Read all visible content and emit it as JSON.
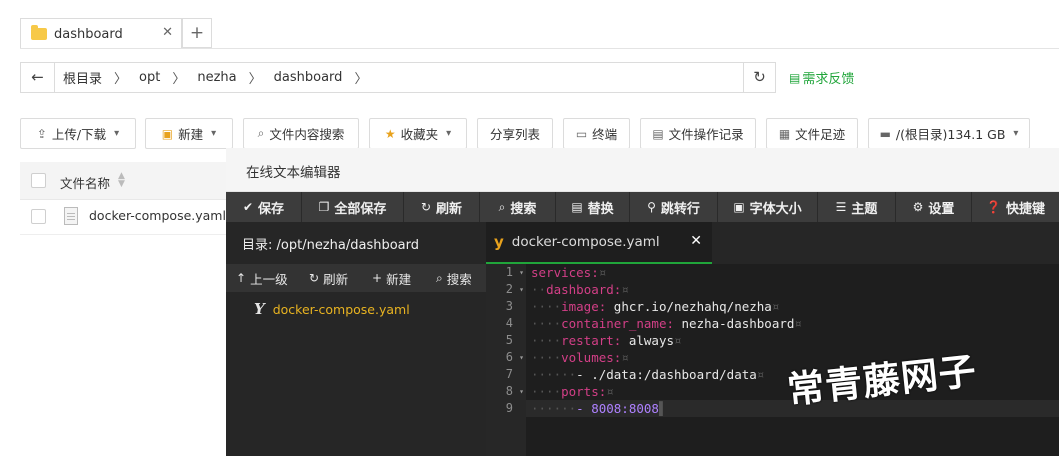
{
  "tabbar": {
    "tab_label": "dashboard",
    "close_glyph": "✕",
    "add_glyph": "+"
  },
  "address": {
    "back_glyph": "←",
    "crumbs": [
      "根目录",
      "opt",
      "nezha",
      "dashboard"
    ],
    "sep_glyph": "〉",
    "refresh_glyph": "↻",
    "feedback_label": "需求反馈"
  },
  "toolbar": {
    "upload": "上传/下载",
    "new": "新建",
    "search_content": "文件内容搜索",
    "favorites": "收藏夹",
    "share_list": "分享列表",
    "terminal": "终端",
    "op_log": "文件操作记录",
    "footprint": "文件足迹",
    "disk": "/(根目录)134.1 GB"
  },
  "filelist": {
    "header_name": "文件名称",
    "rows": [
      {
        "name": "docker-compose.yaml"
      }
    ]
  },
  "editor": {
    "title": "在线文本编辑器",
    "toolbar": [
      "保存",
      "全部保存",
      "刷新",
      "搜索",
      "替换",
      "跳转行",
      "字体大小",
      "主题",
      "设置",
      "快捷键"
    ],
    "dir_label": "目录: /opt/nezha/dashboard",
    "sidebar_actions": [
      "上一级",
      "刷新",
      "新建",
      "搜索"
    ],
    "sidebar_file": "docker-compose.yaml",
    "tab_name": "docker-compose.yaml",
    "tab_close": "✕",
    "line_numbers": [
      "1",
      "2",
      "3",
      "4",
      "5",
      "6",
      "7",
      "8",
      "9"
    ],
    "lines": [
      {
        "key": "services:",
        "val": ""
      },
      {
        "key": "dashboard:",
        "val": ""
      },
      {
        "key": "image:",
        "val": " ghcr.io/nezhahq/nezha"
      },
      {
        "key": "container_name:",
        "val": " nezha-dashboard"
      },
      {
        "key": "restart:",
        "val": " always"
      },
      {
        "key": "volumes:",
        "val": ""
      },
      {
        "key": "",
        "val": "- ./data:/dashboard/data"
      },
      {
        "key": "ports:",
        "val": ""
      },
      {
        "key": "",
        "val": "- 8008:8008"
      }
    ]
  },
  "watermark": "常青藤网子"
}
